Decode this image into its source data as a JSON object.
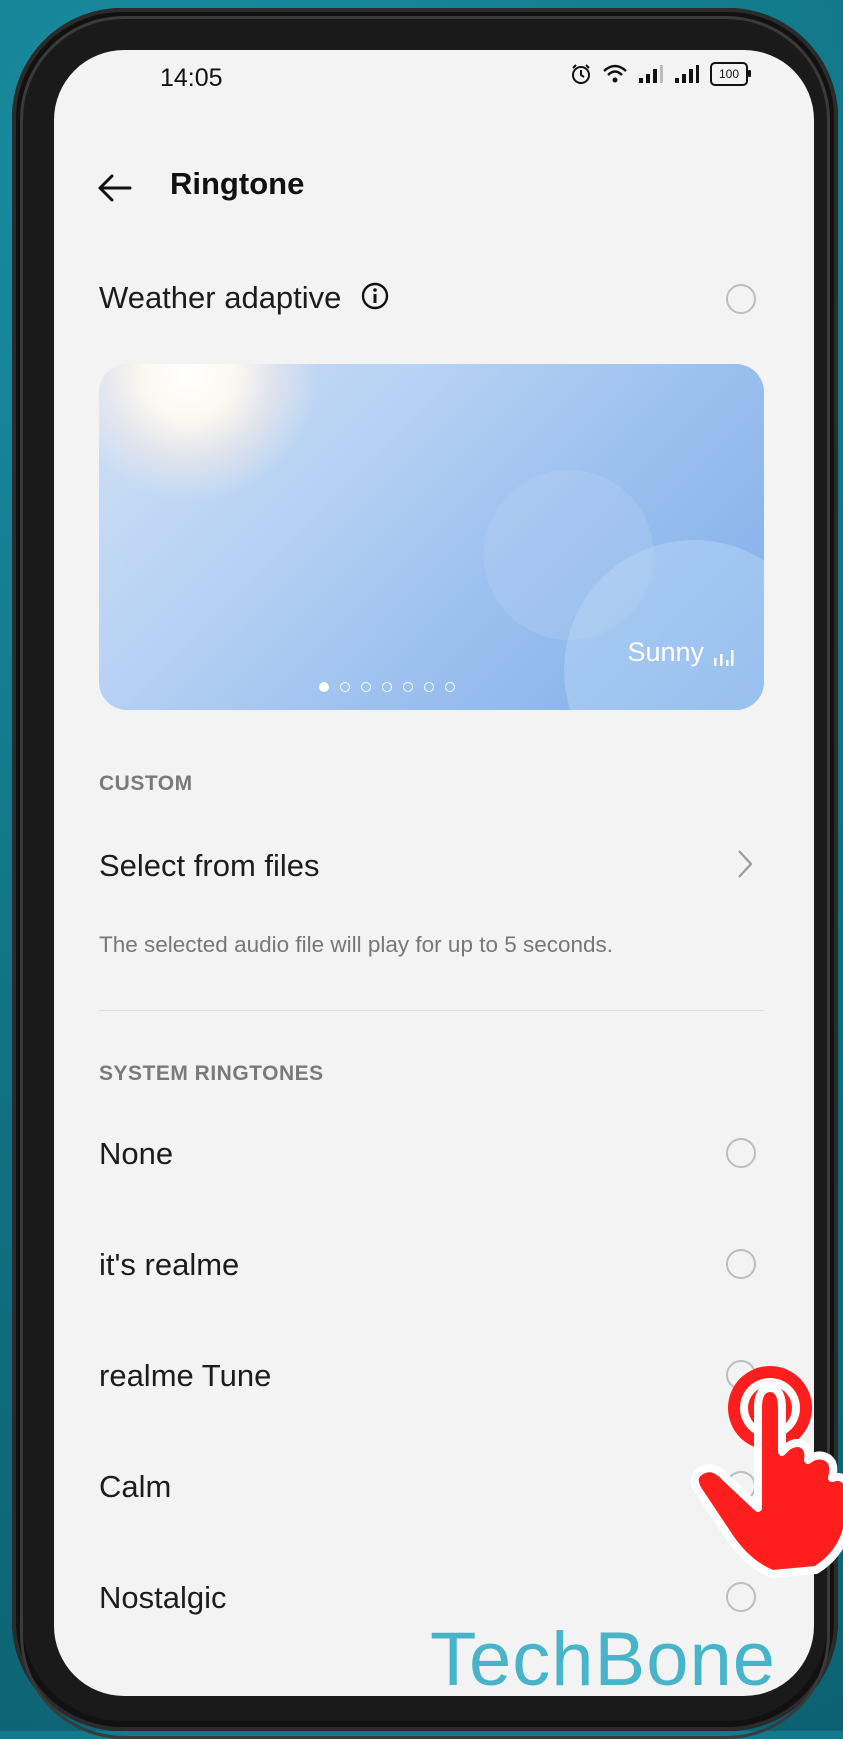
{
  "status_bar": {
    "time": "14:05",
    "battery": "100"
  },
  "header": {
    "title": "Ringtone"
  },
  "weather": {
    "label": "Weather adaptive"
  },
  "banner": {
    "label": "Sunny",
    "pages": 7,
    "active_page": 1
  },
  "custom_section": {
    "header": "CUSTOM",
    "select_label": "Select from files",
    "note": "The selected audio file will play for up to 5 seconds."
  },
  "system_section": {
    "header": "SYSTEM RINGTONES",
    "items": [
      {
        "label": "None"
      },
      {
        "label": "it's realme"
      },
      {
        "label": "realme Tune"
      },
      {
        "label": "Calm"
      },
      {
        "label": "Nostalgic"
      }
    ]
  },
  "watermark": "TechBone",
  "colors": {
    "accent": "#47b4c9",
    "cursor": "#ff1e1e",
    "background": "#127a8c"
  }
}
